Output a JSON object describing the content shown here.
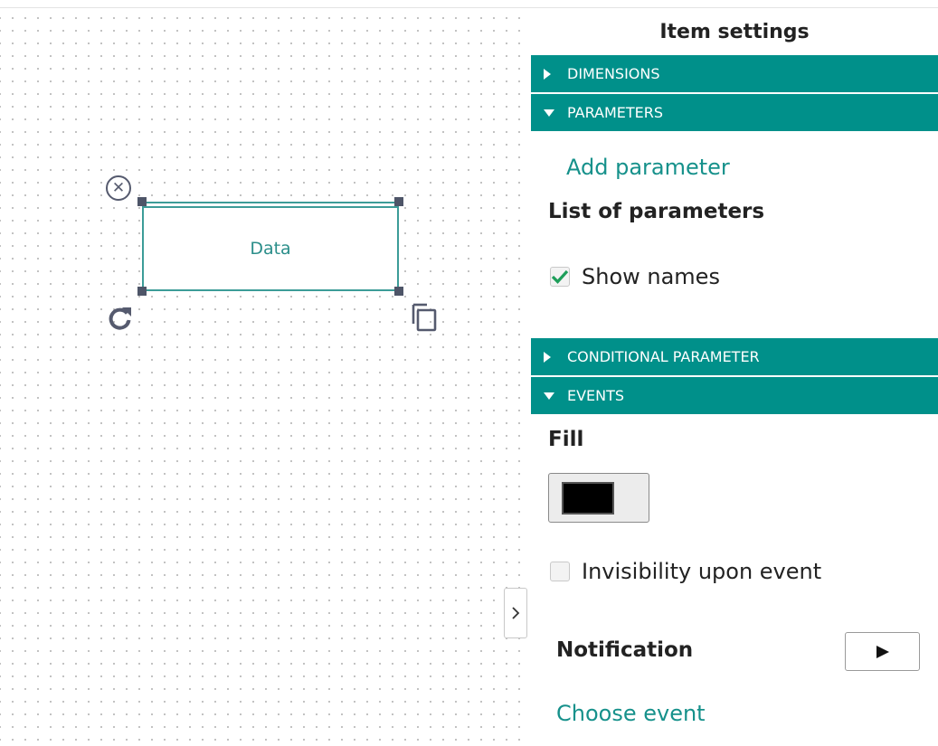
{
  "canvas": {
    "shape": {
      "label": "Data"
    },
    "icons": {
      "delete": "close-icon",
      "rotate": "rotate-icon",
      "duplicate": "copy-icon",
      "collapse": "chevron-right-icon"
    }
  },
  "panel": {
    "title": "Item settings",
    "sections": {
      "dimensions": {
        "label": "DIMENSIONS",
        "state": "collapsed"
      },
      "parameters": {
        "label": "PARAMETERS",
        "state": "expanded"
      },
      "conditional_parameter": {
        "label": "CONDITIONAL PARAMETER",
        "state": "collapsed"
      },
      "events": {
        "label": "EVENTS",
        "state": "expanded"
      }
    },
    "parameters": {
      "add_link": "Add parameter",
      "list_heading": "List of parameters",
      "show_names": {
        "label": "Show names",
        "checked": true
      }
    },
    "events": {
      "fill_heading": "Fill",
      "fill_color": "#000000",
      "invisibility": {
        "label": "Invisibility upon event",
        "checked": false
      },
      "notification_heading": "Notification",
      "choose_event_link": "Choose event"
    }
  },
  "colors": {
    "accent": "#00908a",
    "link": "#16918b",
    "shape_border": "#3c9c98",
    "checkmark": "#1e9e5a"
  }
}
